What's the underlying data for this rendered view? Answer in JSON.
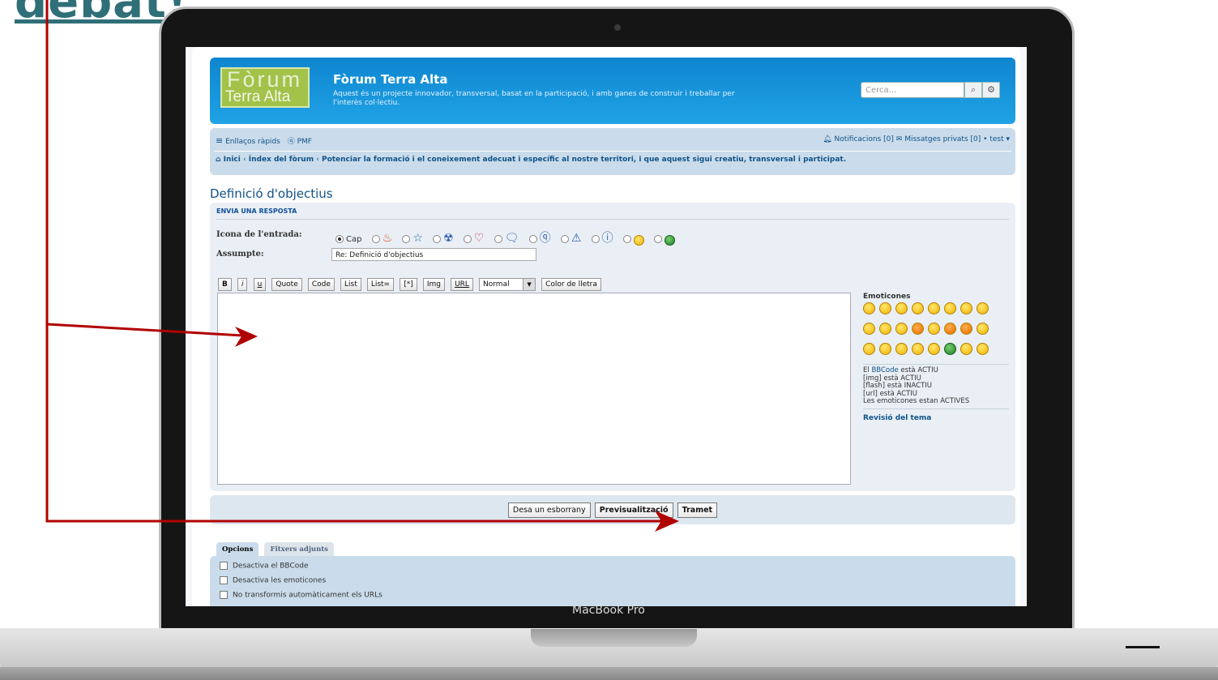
{
  "overlay_title": "debat!",
  "device_label": "MacBook Pro",
  "site": {
    "logo_top": "Fòrum",
    "logo_bottom": "Terra Alta",
    "title": "Fòrum Terra Alta",
    "description": "Aquest és un projecte innovador, transversal, basat en la participació, i amb ganes de construir i treballar per l'interès col·lectiu.",
    "search_placeholder": "Cerca..."
  },
  "nav": {
    "quick_links": "Enllaços ràpids",
    "faq": "PMF",
    "notifications": "Notificacions [0]",
    "private_messages": "Missatges privats [0]",
    "bullet": "•",
    "user": "test ▾",
    "breadcrumbs": [
      "Inici",
      "Índex del fòrum",
      "Potenciar la formació i el coneixement adecuat i específic al nostre territori, i que aquest sigui creatiu, transversal i participat."
    ]
  },
  "page_title": "Definició d'objectius",
  "form": {
    "section_title": "ENVIA UNA RESPOSTA",
    "icon_label": "Icona de l'entrada:",
    "icon_none": "Cap",
    "subject_label": "Assumpte:",
    "subject_value": "Re: Definició d'objectius",
    "toolbar": [
      "B",
      "i",
      "u",
      "Quote",
      "Code",
      "List",
      "List=",
      "[*]",
      "Img",
      "URL"
    ],
    "font_size_value": "Normal",
    "font_color": "Color de lletra"
  },
  "sidebar": {
    "smileys_title": "Emoticones",
    "bbcode_prefix": "El",
    "bbcode_link": "BBCode",
    "bbcode_state": "està ACTIU",
    "img_state": "[img] està ACTIU",
    "flash_state": "[flash] està INACTIU",
    "url_state": "[url] està ACTIU",
    "smileys_state": "Les emoticones estan ACTIVES",
    "topic_review": "Revisió del tema"
  },
  "buttons": {
    "save_draft": "Desa un esborrany",
    "preview": "Previsualització",
    "submit": "Tramet"
  },
  "tabs": [
    "Opcions",
    "Fitxers adjunts"
  ],
  "options": [
    "Desactiva el BBCode",
    "Desactiva les emoticones",
    "No transformis automàticament els URLs"
  ],
  "colors": {
    "header_blue": "#1896dc",
    "nav_bg": "#cadceb",
    "link": "#105289",
    "arrow_red": "#b10000"
  }
}
